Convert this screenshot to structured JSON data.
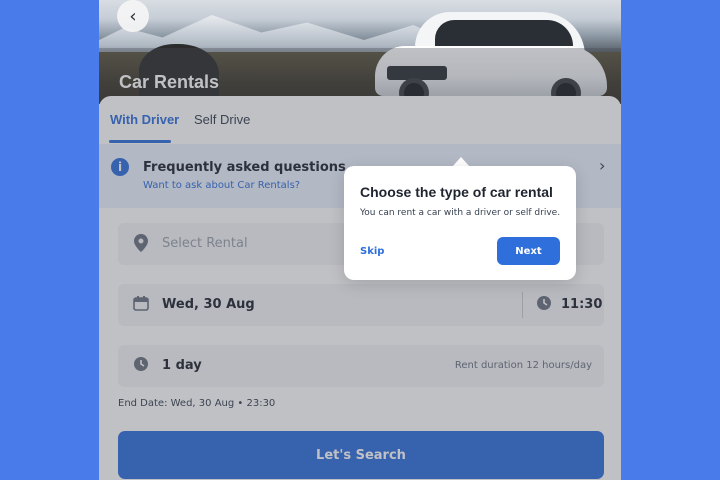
{
  "hero": {
    "title": "Car Rentals",
    "back_icon": "‹"
  },
  "tabs": [
    {
      "label": "With Driver",
      "active": true
    },
    {
      "label": "Self Drive",
      "active": false
    }
  ],
  "faq": {
    "title": "Frequently asked questions",
    "subtitle": "Want to ask about Car Rentals?",
    "info_icon": "i",
    "chevron_icon": "›"
  },
  "form": {
    "location_placeholder": "Select Rental",
    "date": "Wed, 30 Aug",
    "time": "11:30",
    "duration": "1 day",
    "duration_note": "Rent duration 12 hours/day",
    "end_date": "End Date: Wed, 30 Aug  •  23:30",
    "search_label": "Let's Search"
  },
  "tooltip": {
    "title": "Choose the type of car rental",
    "body": "You can rent a car with a driver or self drive.",
    "skip_label": "Skip",
    "next_label": "Next"
  },
  "colors": {
    "background": "#4a7bea",
    "accent": "#2f6fdc"
  }
}
